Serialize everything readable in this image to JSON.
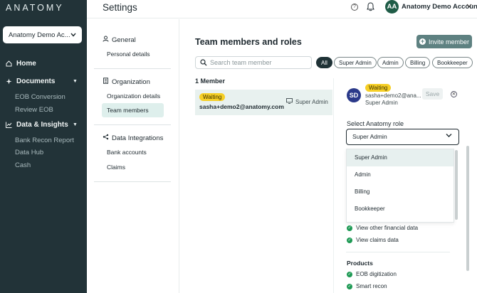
{
  "sidebar": {
    "logo": "ANATOMY",
    "account_select": "Anatomy Demo Ac...",
    "home": "Home",
    "documents": "Documents",
    "documents_items": [
      "EOB Conversion",
      "Review EOB"
    ],
    "data_insights": "Data & Insights",
    "data_items": [
      "Bank Recon Report",
      "Data Hub",
      "Cash"
    ]
  },
  "header": {
    "title": "Settings",
    "avatar_initials": "AA",
    "account_name": "Anatomy Demo Account"
  },
  "settings_nav": {
    "general": "General",
    "general_items": [
      "Personal details"
    ],
    "organization": "Organization",
    "organization_items": [
      "Organization details",
      "Team members"
    ],
    "data_integrations": "Data Integrations",
    "integration_items": [
      "Bank accounts",
      "Claims"
    ]
  },
  "main": {
    "title": "Team members and roles",
    "invite_label": "Invite member",
    "search_placeholder": "Search team member",
    "filters": [
      "All",
      "Super Admin",
      "Admin",
      "Billing",
      "Bookkeeper"
    ],
    "member_count": "1 Member",
    "member": {
      "status": "Waiting",
      "email": "sasha+demo2@anatomy.com",
      "role": "Super Admin"
    }
  },
  "panel": {
    "avatar_initials": "SD",
    "status": "Waiting",
    "email": "sasha+demo2@ana...",
    "role": "Super Admin",
    "save_label": "Save",
    "select_label": "Select Anatomy role",
    "selected_role": "Super Admin",
    "options": [
      "Super Admin",
      "Admin",
      "Billing",
      "Bookkeeper"
    ],
    "permissions": [
      "View other financial data",
      "View claims data"
    ],
    "products_heading": "Products",
    "products": [
      "EOB digitization",
      "Smart recon"
    ]
  },
  "colors": {
    "sidebar_bg": "#223338",
    "accent": "#5e8181",
    "waiting_badge": "#f6cf26",
    "check": "#1f9a55"
  }
}
